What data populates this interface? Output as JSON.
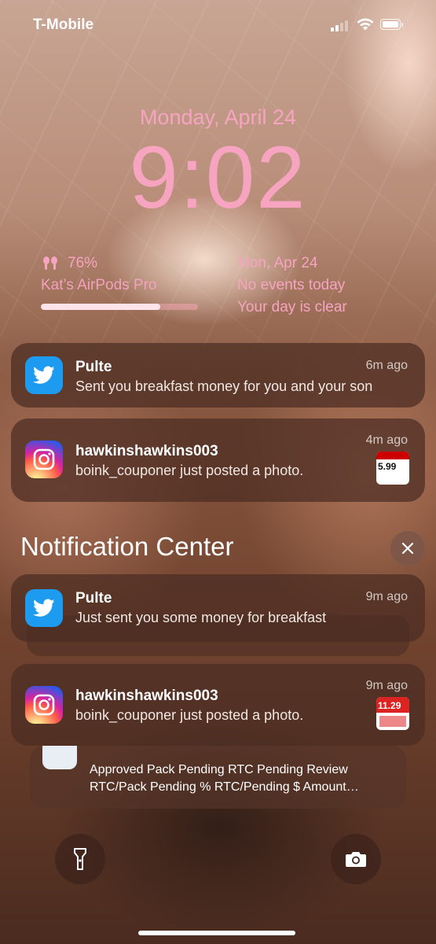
{
  "status_bar": {
    "carrier": "T-Mobile",
    "signal_bars_active": 2,
    "signal_bars_total": 4,
    "battery_level": 1.0
  },
  "lock_screen": {
    "date": "Monday, April 24",
    "time": "9:02"
  },
  "widgets": {
    "batteries": {
      "percent_text": "76%",
      "device_name": "Kat’s AirPods Pro",
      "level": 0.76
    },
    "calendar": {
      "date": "Mon, Apr 24",
      "line1": "No events today",
      "line2": "Your day is clear"
    }
  },
  "notifications_top": [
    {
      "app": "twitter",
      "title": "Pulte",
      "body": "Sent you breakfast money for you and your son",
      "age": "6m ago"
    },
    {
      "app": "instagram",
      "title": "hawkinshawkins003",
      "body": "boink_couponer just posted a photo.",
      "age": "4m ago",
      "thumb_text": "5.99"
    }
  ],
  "notification_center": {
    "title": "Notification Center",
    "items": [
      {
        "app": "twitter",
        "title": "Pulte",
        "body": "Just sent you some money for breakfast",
        "age": "9m ago"
      },
      {
        "app": "instagram",
        "title": "hawkinshawkins003",
        "body": "boink_couponer just posted a photo.",
        "age": "9m ago",
        "thumb_text": "11.29"
      }
    ],
    "partial": {
      "line1": "Approved Pack Pending RTC Pending Review",
      "line2": "RTC/Pack Pending % RTC/Pending $ Amount…"
    }
  },
  "colors": {
    "accent_pink": "#f7a4c1",
    "twitter_blue": "#1d9bf0"
  },
  "icons": [
    "flashlight-icon",
    "camera-icon",
    "close-icon",
    "airpods-icon",
    "twitter-icon",
    "instagram-icon",
    "wifi-icon",
    "battery-icon",
    "signal-icon"
  ]
}
